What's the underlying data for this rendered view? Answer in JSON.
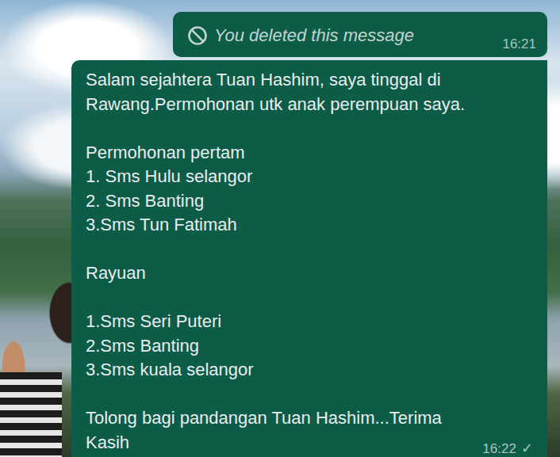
{
  "messages": [
    {
      "kind": "deleted",
      "outgoing": true,
      "text": "You deleted this message",
      "time": "16:21"
    },
    {
      "kind": "text",
      "outgoing": true,
      "paragraphs": [
        [
          "Salam sejahtera Tuan Hashim, saya tinggal di",
          "Rawang.Permohonan utk anak perempuan saya."
        ],
        [
          "Permohonan pertam",
          "1. Sms Hulu selangor",
          "2. Sms Banting",
          "3.Sms Tun Fatimah"
        ],
        [
          "Rayuan"
        ],
        [
          "1.Sms Seri Puteri",
          "2.Sms Banting",
          "3.Sms kuala selangor"
        ],
        [
          "Tolong bagi pandangan Tuan Hashim...Terima",
          "Kasih"
        ]
      ],
      "time": "16:22",
      "status": "✓"
    }
  ]
}
